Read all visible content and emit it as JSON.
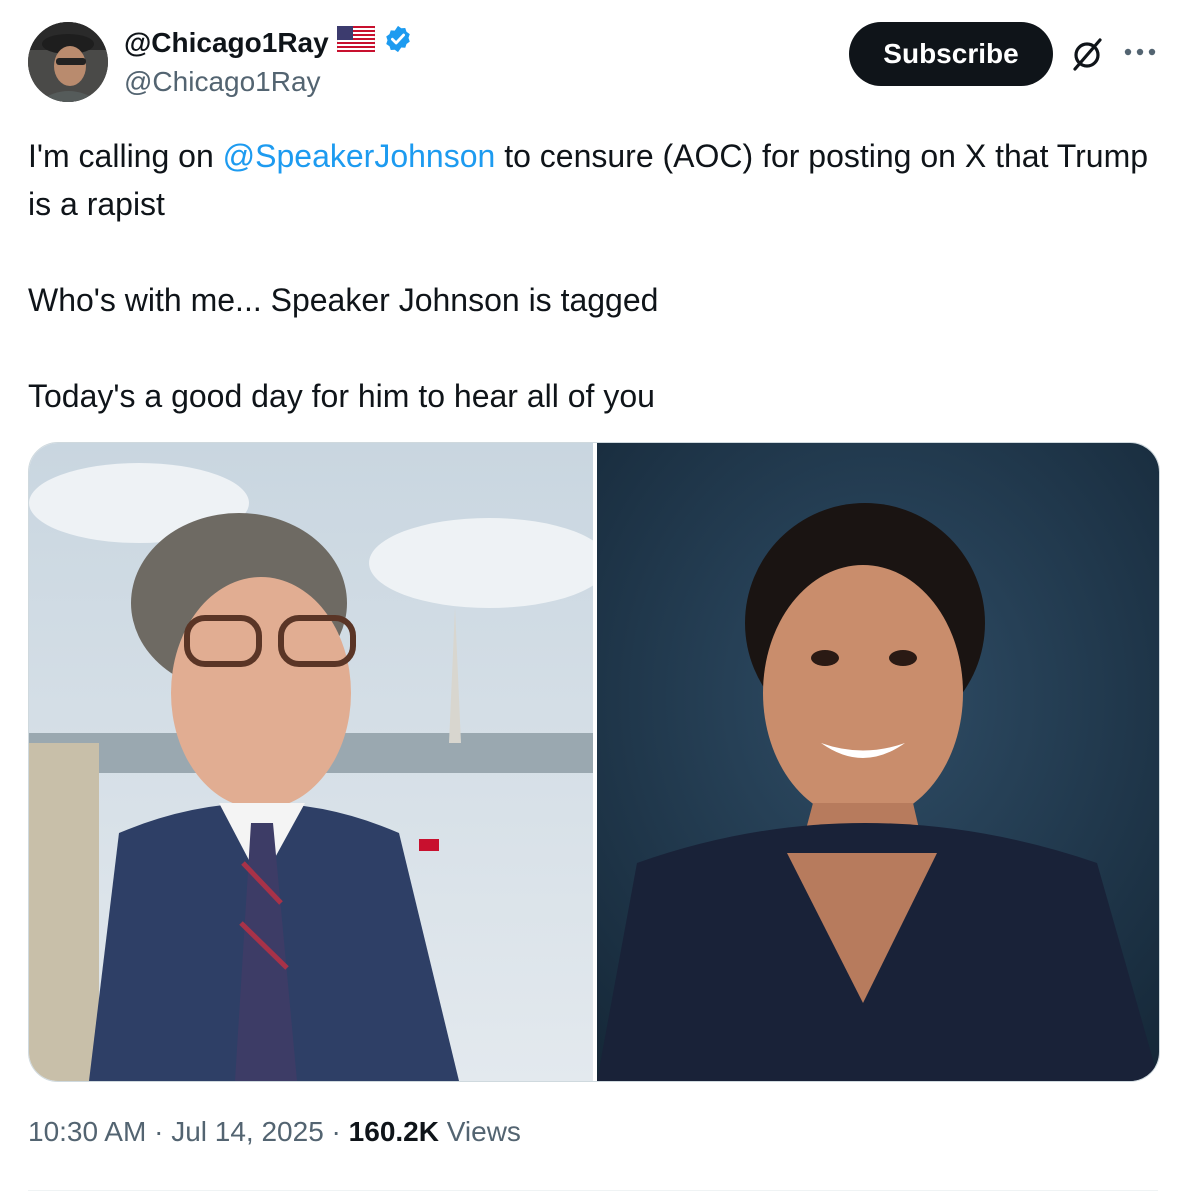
{
  "author": {
    "display_name": "@Chicago1Ray",
    "handle": "@Chicago1Ray",
    "flag_icon": "us-flag-icon",
    "verified_color": "#1d9bf0"
  },
  "actions": {
    "subscribe_label": "Subscribe",
    "grok_icon": "grok-icon",
    "more_icon": "more-icon"
  },
  "tweet": {
    "line1_before": "I'm calling on ",
    "mention": "@SpeakerJohnson",
    "line1_after": " to censure (AOC) for posting on X that Trump is a rapist",
    "line2": "Who's with me... Speaker Johnson is tagged",
    "line3": "Today's a good day for him to hear all of you",
    "mention_color": "#1d9bf0"
  },
  "media": {
    "photos": [
      "photo-speaker-johnson",
      "photo-aoc"
    ]
  },
  "meta": {
    "time": "10:30 AM",
    "sep1": " · ",
    "date": "Jul 14, 2025",
    "sep2": " · ",
    "views_count": "160.2K",
    "views_label": " Views"
  }
}
